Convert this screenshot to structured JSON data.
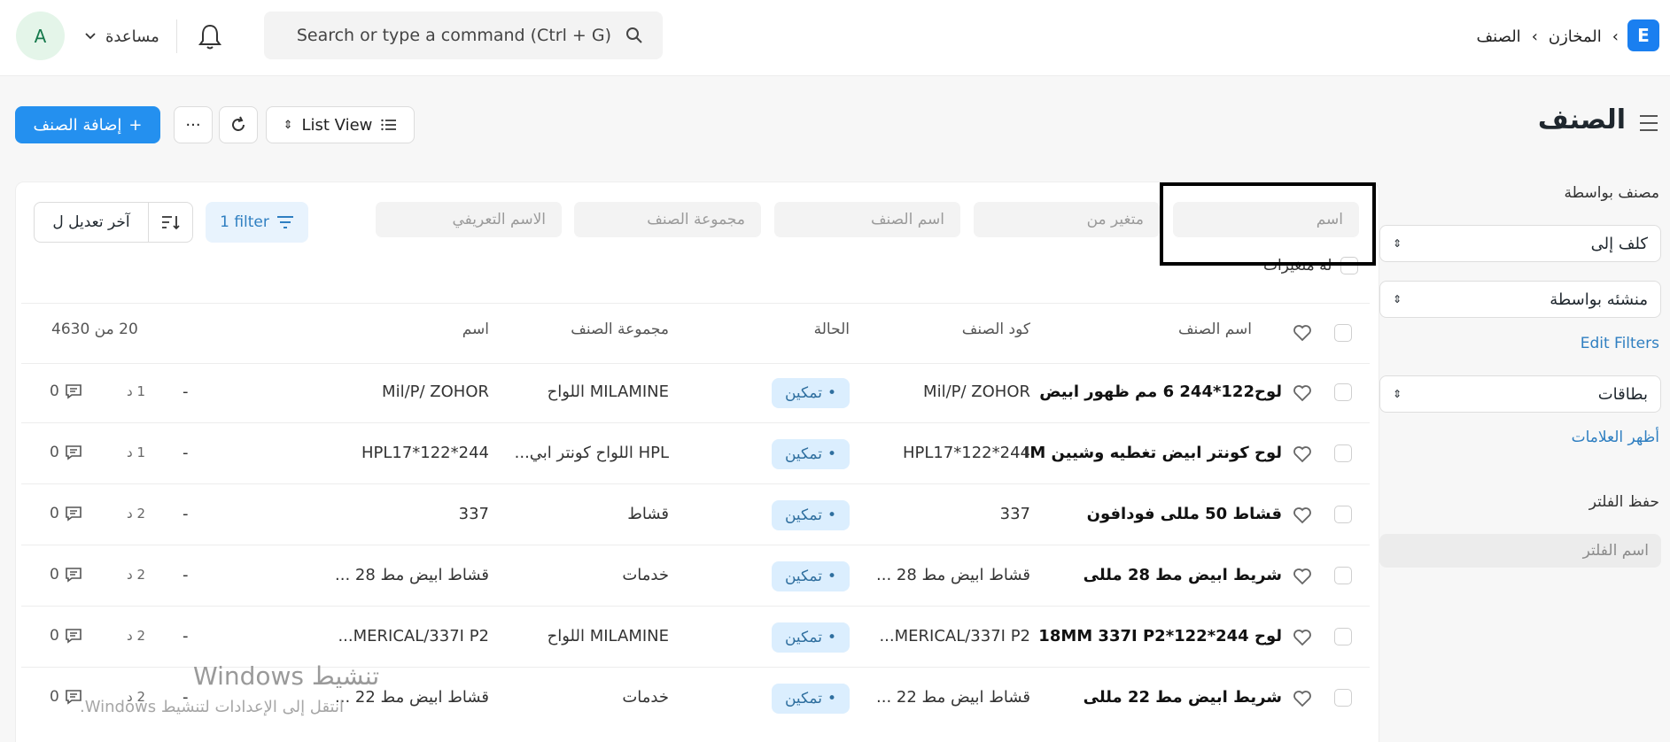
{
  "navbar": {
    "avatar_letter": "A",
    "help_label": "مساعدة",
    "search_placeholder": "Search or type a command (Ctrl + G)",
    "breadcrumb": [
      "المخازن",
      "الصنف"
    ],
    "logo_letter": "E"
  },
  "page": {
    "title": "الصنف",
    "add_button": "إضافة الصنف",
    "view_select": "List View"
  },
  "sidebar": {
    "grouped_by": "مصنف بواسطة",
    "assigned_to": "كلف إلى",
    "created_by": "منشئه بواسطة",
    "edit_filters": "Edit Filters",
    "tags": "بطاقات",
    "show_tags": "أظهر العلامات",
    "save_filter": "حفظ الفلتر",
    "filter_name_placeholder": "اسم الفلتر"
  },
  "filters": {
    "name": "اسم",
    "variant_of": "متغير من",
    "item_name": "اسم الصنف",
    "item_group": "مجموعة الصنف",
    "description_name": "الاسم التعريفي",
    "has_variants": "له متغيرات",
    "filter_button": "1 filter",
    "sort_label": "آخر تعديل ل"
  },
  "table": {
    "headers": {
      "item_name": "اسم الصنف",
      "item_code": "كود الصنف",
      "status": "الحالة",
      "item_group": "مجموعة الصنف",
      "name": "اسم",
      "count": "20 من 4630"
    },
    "rows": [
      {
        "item_name": "لوح122*244 6 مم ظهور ابيض",
        "item_code": "Mil/P/ ZOHOR",
        "status": "تمكين",
        "item_group": "MILAMINE اللواح",
        "name": "Mil/P/ ZOHOR",
        "dash": "-",
        "time": "1 د",
        "comments": "0"
      },
      {
        "item_name": "لوح كونتر ابيض تغطيه وشيين IM",
        "item_code": "HPL17*122*244",
        "status": "تمكين",
        "item_group": "HPL اللواح كونتر ابي...",
        "name": "HPL17*122*244",
        "dash": "-",
        "time": "1 د",
        "comments": "0"
      },
      {
        "item_name": "قشاط 50 مللى فودافون",
        "item_code": "337",
        "status": "تمكين",
        "item_group": "قشاط",
        "name": "337",
        "dash": "-",
        "time": "2 د",
        "comments": "0"
      },
      {
        "item_name": "شريط ابيض مط 28 مللى",
        "item_code": "قشاط ابيض مط 28 ...",
        "status": "تمكين",
        "item_group": "خدمات",
        "name": "قشاط ابيض مط 28 ...",
        "dash": "-",
        "time": "2 د",
        "comments": "0"
      },
      {
        "item_name": "لوح 244*122*18MM 337I P2",
        "item_code": "MERICAL/337I P2...",
        "status": "تمكين",
        "item_group": "MILAMINE اللواح",
        "name": "MERICAL/337I P2...",
        "dash": "-",
        "time": "2 د",
        "comments": "0"
      },
      {
        "item_name": "شريط ابيض مط 22 مللى",
        "item_code": "قشاط ابيض مط 22 ...",
        "status": "تمكين",
        "item_group": "خدمات",
        "name": "قشاط ابيض مط 22 ...",
        "dash": "-",
        "time": "2 د",
        "comments": "0"
      }
    ]
  },
  "watermark": {
    "title": "تنشيط Windows",
    "subtitle": "انتقل إلى الإعدادات لتنشيط Windows."
  }
}
